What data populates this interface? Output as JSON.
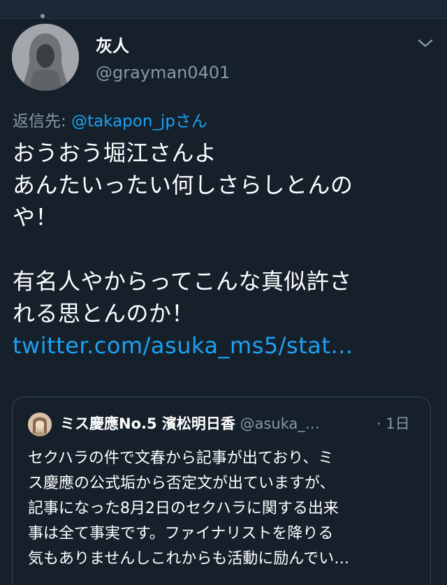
{
  "tweet": {
    "display_name": "灰人",
    "handle": "@grayman0401",
    "reply_prefix": "返信先: ",
    "reply_mention": "@takapon_jpさん",
    "body_lines": [
      "おうおう堀江さんよ",
      "あんたいったい何しさらしとんの",
      "や！",
      "",
      "有名人やからってこんな真似許さ",
      "れる思とんのか！"
    ],
    "link": "twitter.com/asuka_ms5/stat…"
  },
  "quote": {
    "name": "ミス慶應No.5 濱松明日香",
    "handle": "@asuka_…",
    "time": "· 1日",
    "text_lines": [
      "セクハラの件で文春から記事が出ており、ミ",
      "ス慶應の公式垢から否定文が出ていますが、",
      "記事になった8月2日のセクハラに関する出来",
      "事は全て事実です。ファイナリストを降りる",
      "気もありませんしこれからも活動に励んでい…"
    ]
  },
  "icons": {
    "menu": "chevron-down-icon"
  },
  "colors": {
    "background": "#15202b",
    "link": "#1da1f2",
    "muted": "#8899a6",
    "border": "#38444d"
  }
}
